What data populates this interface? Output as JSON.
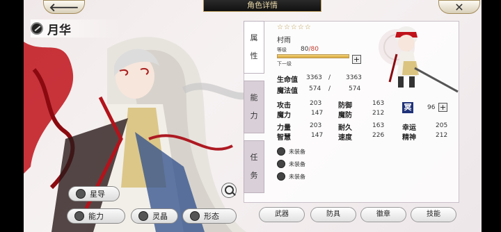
{
  "header": {
    "title": "角色详情",
    "back_label": "🡐",
    "close_label": "✕"
  },
  "character": {
    "name": "月华"
  },
  "left_buttons": {
    "star_guide": "星导",
    "ability": "能力",
    "spirit": "灵晶",
    "form": "形态"
  },
  "side_tabs": {
    "attributes": [
      "属",
      "性"
    ],
    "ability": [
      "能",
      "力"
    ],
    "tasks": [
      "任",
      "务"
    ]
  },
  "weapon": {
    "stars": "☆☆☆☆☆",
    "name": "村雨",
    "level_label": "等级",
    "level": "80",
    "level_max": "80",
    "level_progress": 1.0,
    "next_label": "下一级",
    "plus": "+"
  },
  "vitals": {
    "hp_label": "生命值",
    "hp": "3363",
    "hp_max": "3363",
    "mp_label": "魔法值",
    "mp": "574",
    "mp_max": "574",
    "sep": "/"
  },
  "stats": [
    {
      "name": "攻击",
      "value": "203"
    },
    {
      "name": "防御",
      "value": "163"
    },
    {
      "name": "魔力",
      "value": "147"
    },
    {
      "name": "魔防",
      "value": "212"
    },
    {
      "name": "力量",
      "value": "203"
    },
    {
      "name": "耐久",
      "value": "163"
    },
    {
      "name": "幸运",
      "value": "205"
    },
    {
      "name": "智慧",
      "value": "147"
    },
    {
      "name": "速度",
      "value": "226"
    },
    {
      "name": "精神",
      "value": "212"
    }
  ],
  "rank": {
    "glyph": "冥",
    "value": "96",
    "plus": "+"
  },
  "equipment": [
    {
      "label": "未装备"
    },
    {
      "label": "未装备"
    },
    {
      "label": "未装备"
    }
  ],
  "bottom_tabs": {
    "weapon": "武器",
    "armor": "防具",
    "badge": "徽章",
    "skill": "技能"
  },
  "colors": {
    "accent_gold": "#b89a5a",
    "level_red": "#c0392b",
    "rank_blue": "#20337a"
  }
}
